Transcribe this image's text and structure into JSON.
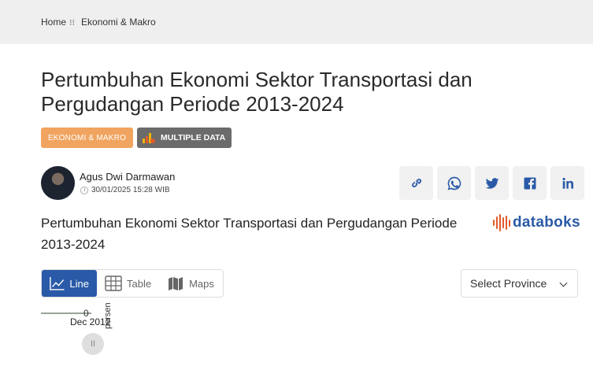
{
  "breadcrumb": {
    "home": "Home",
    "separator": "⁝⁝",
    "category": "Ekonomi & Makro"
  },
  "article": {
    "title": "Pertumbuhan Ekonomi Sektor Transportasi dan Pergudangan Periode 2013-2024",
    "category_badge": "EKONOMI & MAKRO",
    "multi_badge": "MULTIPLE DATA",
    "author": "Agus Dwi Darmawan",
    "date": "30/01/2025 15:28 WIB"
  },
  "share": {
    "icons": [
      "link-icon",
      "whatsapp-icon",
      "twitter-icon",
      "facebook-icon",
      "linkedin-icon"
    ]
  },
  "chart_section": {
    "title": "Pertumbuhan Ekonomi Sektor Transportasi dan Pergudangan Periode 2013-2024",
    "logo": "databoks",
    "tabs": {
      "line": "Line",
      "table": "Table",
      "maps": "Maps"
    },
    "province_select": "Select Province",
    "ylabel": "persen",
    "y_zero": "0",
    "x_tick": "Dec 2012",
    "play_label": "II"
  },
  "colors": {
    "accent": "#2a5aa7",
    "category_badge": "#f0a45f",
    "multi_badge": "#6b6b6b",
    "logo_bars": "#e05a2b"
  }
}
